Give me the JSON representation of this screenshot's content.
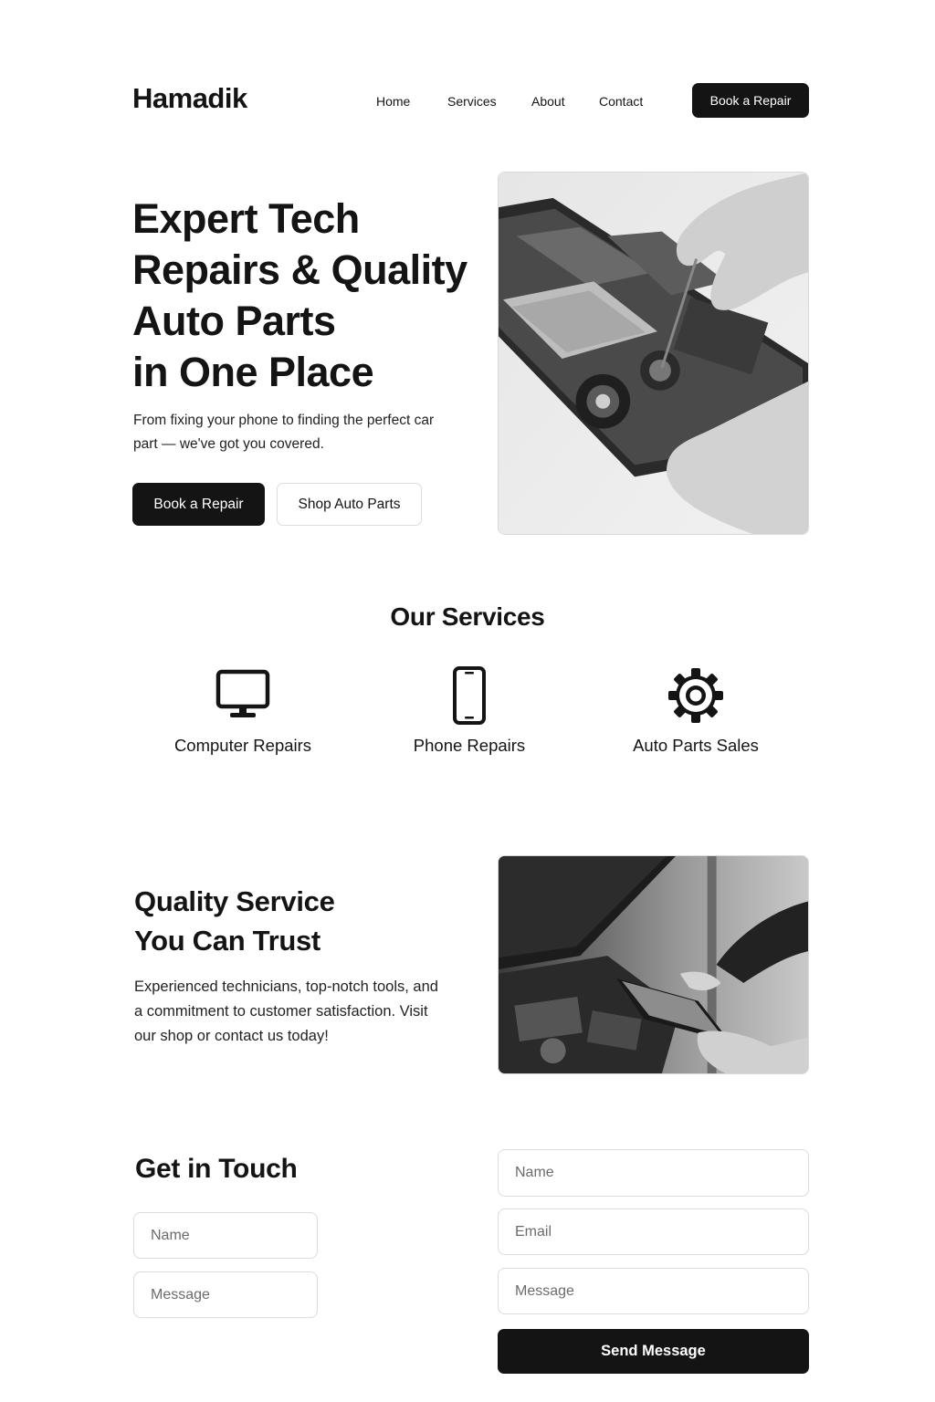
{
  "header": {
    "logo": "Hamadik",
    "nav": [
      {
        "label": "Home"
      },
      {
        "label": "Services"
      },
      {
        "label": "About"
      },
      {
        "label": "Contact"
      }
    ],
    "cta_label": "Book a Repair"
  },
  "hero": {
    "title_lines": [
      "Expert Tech",
      "Repairs & Quality",
      "Auto Parts",
      "in One Place"
    ],
    "subtitle": "From fixing your phone to finding the perfect car part — we've got you covered.",
    "primary_button": "Book a Repair",
    "secondary_button": "Shop Auto Parts",
    "image_icon": "laptop-repair-photo"
  },
  "services": {
    "title": "Our Services",
    "items": [
      {
        "label": "Computer Repairs",
        "icon": "monitor-icon"
      },
      {
        "label": "Phone Repairs",
        "icon": "smartphone-icon"
      },
      {
        "label": "Auto Parts Sales",
        "icon": "gear-icon"
      }
    ]
  },
  "quality": {
    "title_lines": [
      "Quality Service",
      "You Can Trust"
    ],
    "text": "Experienced technicians, top-notch tools, and a commitment to customer satisfaction. Visit our shop or contact us today!",
    "image_icon": "car-engine-tablet-photo"
  },
  "contact": {
    "title": "Get in Touch",
    "left_form": {
      "name_placeholder": "Name",
      "message_placeholder": "Message"
    },
    "right_form": {
      "name_placeholder": "Name",
      "email_placeholder": "Email",
      "message_placeholder": "Message",
      "submit_label": "Send Message"
    }
  },
  "colors": {
    "text": "#141414",
    "button_dark": "#141414",
    "border": "#dcdcdc",
    "background": "#ffffff"
  }
}
